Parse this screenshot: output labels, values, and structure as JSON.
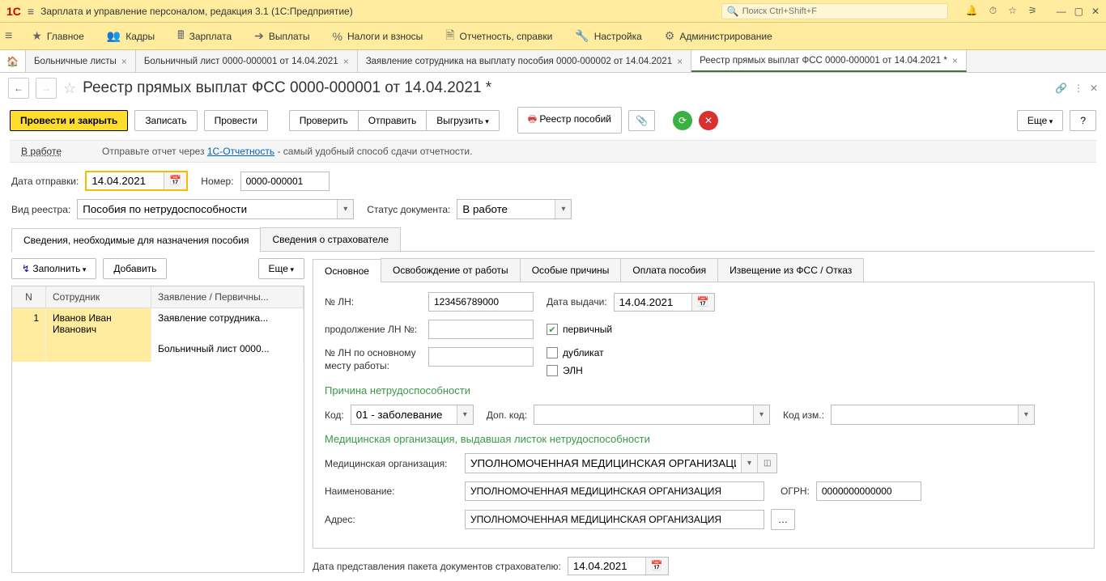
{
  "titlebar": {
    "title": "Зарплата и управление персоналом, редакция 3.1  (1С:Предприятие)",
    "search_placeholder": "Поиск Ctrl+Shift+F"
  },
  "mainmenu": {
    "items": [
      {
        "icon": "≡",
        "label": "Главное"
      },
      {
        "icon": "👥",
        "label": "Кадры"
      },
      {
        "icon": "🖩",
        "label": "Зарплата"
      },
      {
        "icon": "➔",
        "label": "Выплаты"
      },
      {
        "icon": "%",
        "label": "Налоги и взносы"
      },
      {
        "icon": "🗎",
        "label": "Отчетность, справки"
      },
      {
        "icon": "🔧",
        "label": "Настройка"
      },
      {
        "icon": "⚙",
        "label": "Администрирование"
      }
    ]
  },
  "tabs": [
    {
      "label": "Больничные листы",
      "active": false
    },
    {
      "label": "Больничный лист 0000-000001 от 14.04.2021",
      "active": false
    },
    {
      "label": "Заявление сотрудника на выплату пособия 0000-000002 от 14.04.2021",
      "active": false
    },
    {
      "label": "Реестр прямых выплат ФСС 0000-000001 от 14.04.2021 *",
      "active": true
    }
  ],
  "page": {
    "title": "Реестр прямых выплат ФСС 0000-000001 от 14.04.2021 *"
  },
  "toolbar": {
    "post_close": "Провести и закрыть",
    "save": "Записать",
    "post": "Провести",
    "check": "Проверить",
    "send": "Отправить",
    "export": "Выгрузить",
    "registry": "Реестр пособий",
    "more": "Еще"
  },
  "infobar": {
    "status": "В работе",
    "text_pre": "Отправьте отчет через ",
    "link": "1С-Отчетность",
    "text_post": " - самый удобный способ сдачи отчетности."
  },
  "form": {
    "date_label": "Дата отправки:",
    "date_value": "14.04.2021",
    "number_label": "Номер:",
    "number_value": "0000-000001",
    "type_label": "Вид реестра:",
    "type_value": "Пособия по нетрудоспособности",
    "status_label": "Статус документа:",
    "status_value": "В работе"
  },
  "inner_tabs": [
    {
      "label": "Сведения, необходимые для назначения пособия",
      "active": true
    },
    {
      "label": "Сведения о страхователе",
      "active": false
    }
  ],
  "left_panel": {
    "fill": "Заполнить",
    "add": "Добавить",
    "more": "Еще",
    "columns": {
      "n": "N",
      "emp": "Сотрудник",
      "doc": "Заявление / Первичны..."
    },
    "rows": [
      {
        "n": "1",
        "emp": "Иванов Иван Иванович",
        "doc": "Заявление сотрудника..."
      },
      {
        "n": "",
        "emp": "",
        "doc": "Больничный лист 0000..."
      }
    ]
  },
  "detail_tabs": [
    {
      "label": "Основное",
      "active": true
    },
    {
      "label": "Освобождение от работы",
      "active": false
    },
    {
      "label": "Особые причины",
      "active": false
    },
    {
      "label": "Оплата пособия",
      "active": false
    },
    {
      "label": "Извещение из ФСС / Отказ",
      "active": false
    }
  ],
  "detail": {
    "ln_label": "№ ЛН:",
    "ln_value": "123456789000",
    "issue_date_label": "Дата выдачи:",
    "issue_date_value": "14.04.2021",
    "cont_ln_label": "продолжение ЛН №:",
    "main_ln_label": "№ ЛН по основному месту работы:",
    "primary_label": "первичный",
    "duplicate_label": "дубликат",
    "eln_label": "ЭЛН",
    "reason_title": "Причина нетрудоспособности",
    "code_label": "Код:",
    "code_value": "01 - заболевание",
    "add_code_label": "Доп. код:",
    "chg_code_label": "Код изм.:",
    "med_title": "Медицинская организация, выдавшая листок нетрудоспособности",
    "med_org_label": "Медицинская организация:",
    "med_org_value": "УПОЛНОМОЧЕННАЯ МЕДИЦИНСКАЯ ОРГАНИЗАЦИЯ",
    "name_label": "Наименование:",
    "name_value": "УПОЛНОМОЧЕННАЯ МЕДИЦИНСКАЯ ОРГАНИЗАЦИЯ",
    "ogrn_label": "ОГРН:",
    "ogrn_value": "0000000000000",
    "addr_label": "Адрес:",
    "addr_value": "УПОЛНОМОЧЕННАЯ МЕДИЦИНСКАЯ ОРГАНИЗАЦИЯ"
  },
  "bottom": {
    "label": "Дата представления пакета документов страхователю:",
    "value": "14.04.2021"
  }
}
